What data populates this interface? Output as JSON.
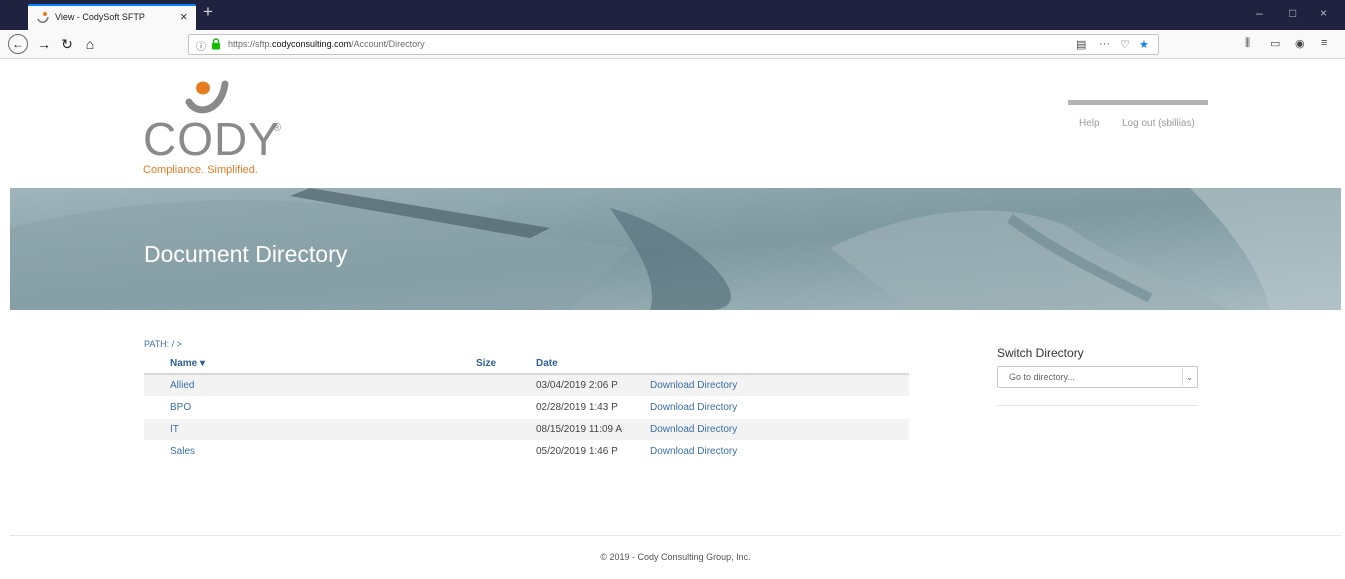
{
  "browser": {
    "tab_title": "View - CodySoft SFTP",
    "tab_close": "×",
    "new_tab": "+",
    "url_prefix": "https://sftp.",
    "url_domain": "codyconsulting.com",
    "url_path": "/Account/Directory",
    "window_controls": [
      "–",
      "□",
      "×"
    ],
    "icons": [
      "back-icon",
      "forward-icon",
      "reload-icon",
      "home-icon",
      "info-icon",
      "lock-icon",
      "reader-view-icon",
      "more-icon",
      "pocket-icon",
      "bookmark-star-icon",
      "library-icon",
      "sidebar-icon",
      "account-icon",
      "menu-icon"
    ]
  },
  "header": {
    "logo_word": "CODY",
    "logo_reg": "®",
    "logo_tagline": "Compliance. Simplified.",
    "help_link": "Help",
    "logout_link": "Log out (sbillias)"
  },
  "hero": {
    "title": "Document Directory"
  },
  "directory": {
    "path_label": "PATH: / >",
    "columns": {
      "name": "Name",
      "size": "Size",
      "date": "Date"
    },
    "sort_indicator": "chevron-down-icon",
    "rows": [
      {
        "name": "Allied",
        "size": "",
        "date": "03/04/2019 2:06 P",
        "action": "Download Directory"
      },
      {
        "name": "BPO",
        "size": "",
        "date": "02/28/2019 1:43 P",
        "action": "Download Directory"
      },
      {
        "name": "IT",
        "size": "",
        "date": "08/15/2019 11:09 A",
        "action": "Download Directory"
      },
      {
        "name": "Sales",
        "size": "",
        "date": "05/20/2019 1:46 P",
        "action": "Download Directory"
      }
    ]
  },
  "switch_directory": {
    "title": "Switch Directory",
    "placeholder": "Go to directory..."
  },
  "footer": {
    "copyright": "© 2019 - Cody Consulting Group, Inc."
  },
  "colors": {
    "link": "#3b6fa8",
    "brand_orange": "#e57c22",
    "logo_gray": "#8a8a8a",
    "titlebar": "#202340",
    "hero_tint": "#8ea6ad"
  }
}
